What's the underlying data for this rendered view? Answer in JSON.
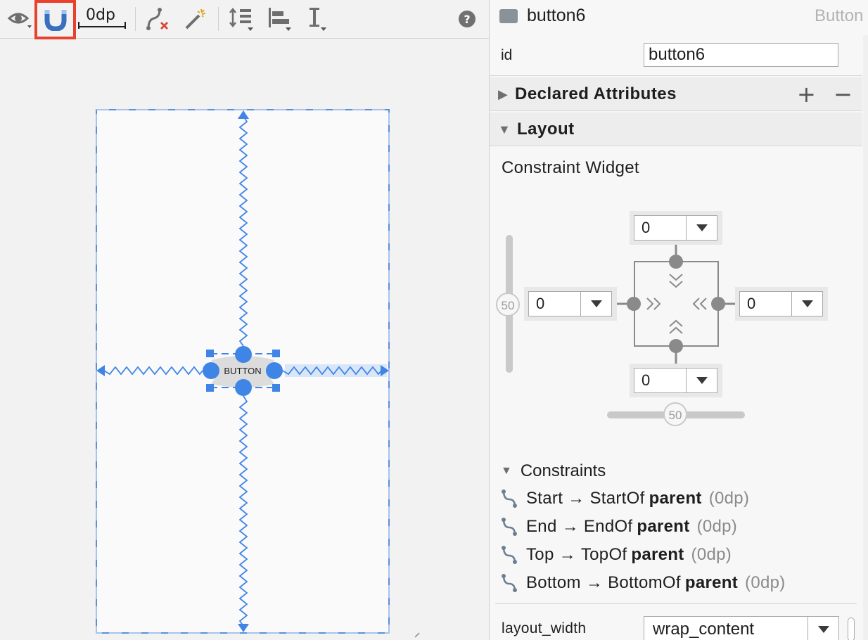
{
  "toolbar": {
    "margin_value": "0dp",
    "icons": [
      "eye-icon",
      "magnet-icon",
      "clear-constraints-icon",
      "infer-constraints-icon",
      "pack-icon",
      "align-icon",
      "guidelines-icon",
      "help-icon"
    ],
    "help_label": "?",
    "magnet_highlight_color": "#e8412d"
  },
  "canvas": {
    "button_label": "BUTTON",
    "constraint_color": "#3f85e6"
  },
  "attributes": {
    "component_name": "button6",
    "component_type": "Button",
    "id_label": "id",
    "id_value": "button6",
    "declared_attributes_title": "Declared Attributes",
    "add_label": "+",
    "remove_label": "−",
    "layout_title": "Layout",
    "constraint_widget_title": "Constraint Widget",
    "margin_top": "0",
    "margin_left": "0",
    "margin_right": "0",
    "margin_bottom": "0",
    "vertical_bias": "50",
    "horizontal_bias": "50",
    "constraints_title": "Constraints",
    "constraints": [
      {
        "side": "Start",
        "arrow": "→",
        "target": "StartOf",
        "parent": "parent",
        "margin": "(0dp)"
      },
      {
        "side": "End",
        "arrow": "→",
        "target": "EndOf",
        "parent": "parent",
        "margin": "(0dp)"
      },
      {
        "side": "Top",
        "arrow": "→",
        "target": "TopOf",
        "parent": "parent",
        "margin": "(0dp)"
      },
      {
        "side": "Bottom",
        "arrow": "→",
        "target": "BottomOf",
        "parent": "parent",
        "margin": "(0dp)"
      }
    ],
    "layout_width_label": "layout_width",
    "layout_width_value": "wrap_content"
  }
}
